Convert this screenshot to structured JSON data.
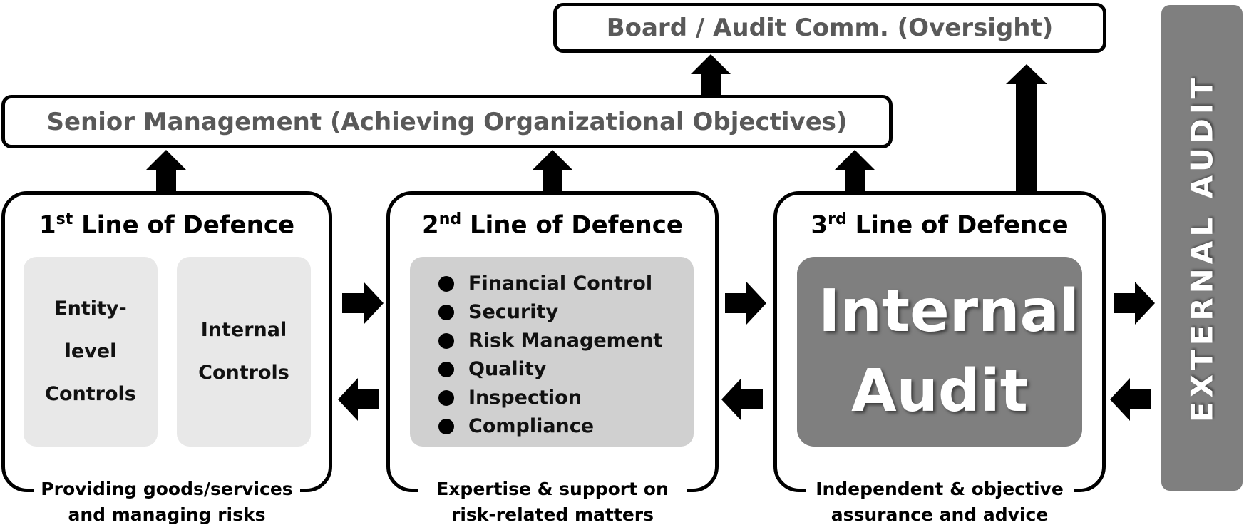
{
  "diagram": {
    "board": {
      "label": "Board / Audit Comm. (Oversight)"
    },
    "senior_management": {
      "label": "Senior Management (Achieving Organizational Objectives)"
    },
    "lines": [
      {
        "ordinal": "1",
        "suffix": "st",
        "title": "Line of Defence",
        "sub_boxes": [
          "Entity-\nlevel\nControls",
          "Internal\nControls"
        ],
        "caption": "Providing goods/services and managing risks"
      },
      {
        "ordinal": "2",
        "suffix": "nd",
        "title": "Line of Defence",
        "items": [
          "Financial Control",
          "Security",
          "Risk Management",
          "Quality",
          "Inspection",
          "Compliance"
        ],
        "caption": "Expertise & support on risk-related matters"
      },
      {
        "ordinal": "3",
        "suffix": "rd",
        "title": "Line of Defence",
        "highlight": "Internal Audit",
        "caption": "Independent & objective assurance and advice"
      }
    ],
    "external_audit": {
      "label": "EXTERNAL AUDIT"
    },
    "colors": {
      "line_border": "#000000",
      "top_text": "#595959",
      "sub_box_1": "#e8e8e8",
      "sub_box_2": "#d0d0d0",
      "internal_audit": "#7f7f7f",
      "external_audit": "#7f7f7f"
    },
    "arrows": [
      "line1-to-senior",
      "line2-to-senior",
      "line3-to-senior",
      "senior-to-board",
      "line3-to-board",
      "line1-to-line2",
      "line2-to-line1",
      "line2-to-line3",
      "line3-to-line2",
      "line3-to-external",
      "external-to-line3"
    ]
  }
}
